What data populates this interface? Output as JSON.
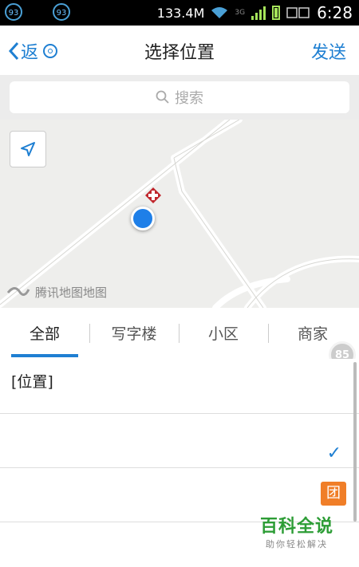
{
  "status_bar": {
    "notif_1": "93",
    "notif_2": "93",
    "speed": "133.4M",
    "network": "3G",
    "time": "6:28"
  },
  "header": {
    "back_label": "返",
    "title": "选择位置",
    "send_label": "发送"
  },
  "search": {
    "placeholder": "搜索"
  },
  "map": {
    "logo_text": "腾讯地图地图",
    "pin_color": "#1e7fe8"
  },
  "tabs": [
    {
      "label": "全部",
      "active": true
    },
    {
      "label": "写字楼",
      "active": false
    },
    {
      "label": "小区",
      "active": false
    },
    {
      "label": "商家",
      "active": false
    }
  ],
  "floating_badge": "85",
  "list": {
    "rows": [
      {
        "label": "[位置]",
        "selected": false
      },
      {
        "label": "",
        "selected": true
      },
      {
        "label": "",
        "selected": false
      }
    ]
  },
  "tuan_badge": "团",
  "watermark": {
    "main": "百科全说",
    "sub": "助你轻松解决"
  },
  "colors": {
    "accent": "#1e7fd2",
    "tuan": "#f07e28",
    "watermark": "#2d9d36"
  }
}
